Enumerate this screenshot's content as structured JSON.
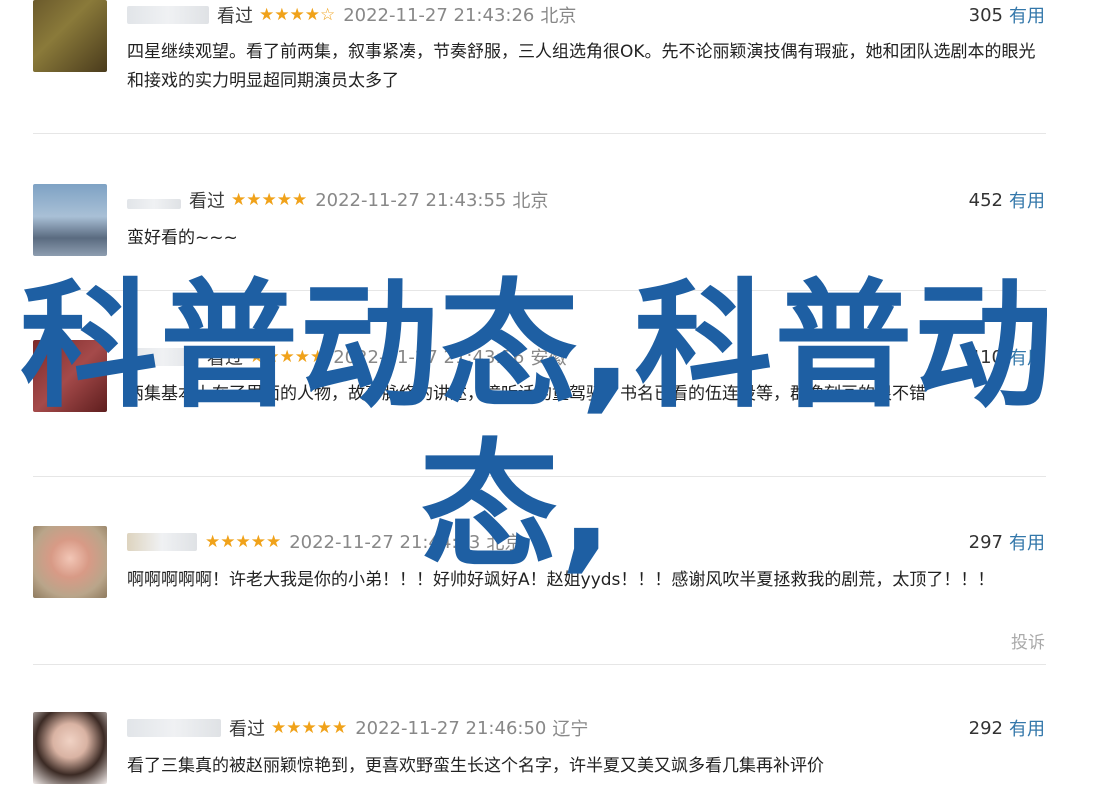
{
  "overlay_title": {
    "line1": "科普动态,科普动",
    "line2": "态,"
  },
  "comments": [
    {
      "username": "",
      "status": "看过",
      "stars": "★★★★☆",
      "time": "2022-11-27 21:43:26",
      "location": "北京",
      "votes": "305",
      "vote_label": "有用",
      "text": "四星继续观望。看了前两集，叙事紧凑，节奏舒服，三人组选角很OK。先不论丽颖演技偶有瑕疵，她和团队选剧本的眼光和接戏的实力明显超同期演员太多了",
      "report": ""
    },
    {
      "username": "",
      "status": "看过",
      "stars": "★★★★★",
      "time": "2022-11-27 21:43:55",
      "location": "北京",
      "votes": "452",
      "vote_label": "有用",
      "text": "蛮好看的~~~",
      "report": ""
    },
    {
      "username": "",
      "status": "看过",
      "stars": "★★★★★",
      "time": "2022-11-27 21:43:56",
      "location": "安徽",
      "votes": "410",
      "vote_label": "有用",
      "text": "两集基本上在了里面的人物，故事脉络的讲述，撞听话的童驾骑，书名已看的伍连设等，群像刻画的很不错",
      "report": ""
    },
    {
      "username": "",
      "status": "",
      "stars": "★★★★★",
      "time": "2022-11-27 21:44:13",
      "location": "北京",
      "votes": "297",
      "vote_label": "有用",
      "text": "啊啊啊啊啊！许老大我是你的小弟！！！好帅好飒好A！赵姐yyds！！！感谢风吹半夏拯救我的剧荒，太顶了！！！",
      "report": "投诉"
    },
    {
      "username": "",
      "status": "看过",
      "stars": "★★★★★",
      "time": "2022-11-27 21:46:50",
      "location": "辽宁",
      "votes": "292",
      "vote_label": "有用",
      "text": "看了三集真的被赵丽颖惊艳到，更喜欢野蛮生长这个名字，许半夏又美又飒多看几集再补评价",
      "report": ""
    }
  ],
  "colors": {
    "link": "#3377aa",
    "star": "#f0a21a",
    "overlay": "#1e5fa3",
    "divider": "#e6e6e6"
  }
}
